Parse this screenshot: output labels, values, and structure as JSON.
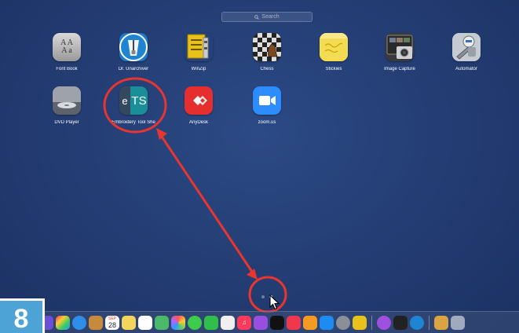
{
  "search": {
    "placeholder": "Search"
  },
  "apps_row1": [
    {
      "label": "Font Book",
      "icon": "font-book-icon"
    },
    {
      "label": "Dr. Unarchiver",
      "icon": "unarchiver-icon"
    },
    {
      "label": "WinZip",
      "icon": "winzip-icon"
    },
    {
      "label": "Chess",
      "icon": "chess-icon"
    },
    {
      "label": "Stickies",
      "icon": "stickies-icon"
    },
    {
      "label": "Image Capture",
      "icon": "image-capture-icon"
    },
    {
      "label": "Automator",
      "icon": "automator-icon"
    }
  ],
  "apps_row2": [
    {
      "label": "DVD Player",
      "icon": "dvd-player-icon"
    },
    {
      "label": "Embroidery Tool She",
      "icon": "embroidery-tool-shed-icon",
      "icon_text_left": "e",
      "icon_text_right": "TS"
    },
    {
      "label": "AnyDesk",
      "icon": "anydesk-icon"
    },
    {
      "label": "zoom.us",
      "icon": "zoom-icon"
    }
  ],
  "calendar": {
    "month": "SEP",
    "day": "28"
  },
  "page_indicator": {
    "pages": 2,
    "current": 2
  },
  "step_badge": "8",
  "colors": {
    "background": "#223a6d",
    "annotation": "#e8352f",
    "badge": "#4da3d6"
  }
}
